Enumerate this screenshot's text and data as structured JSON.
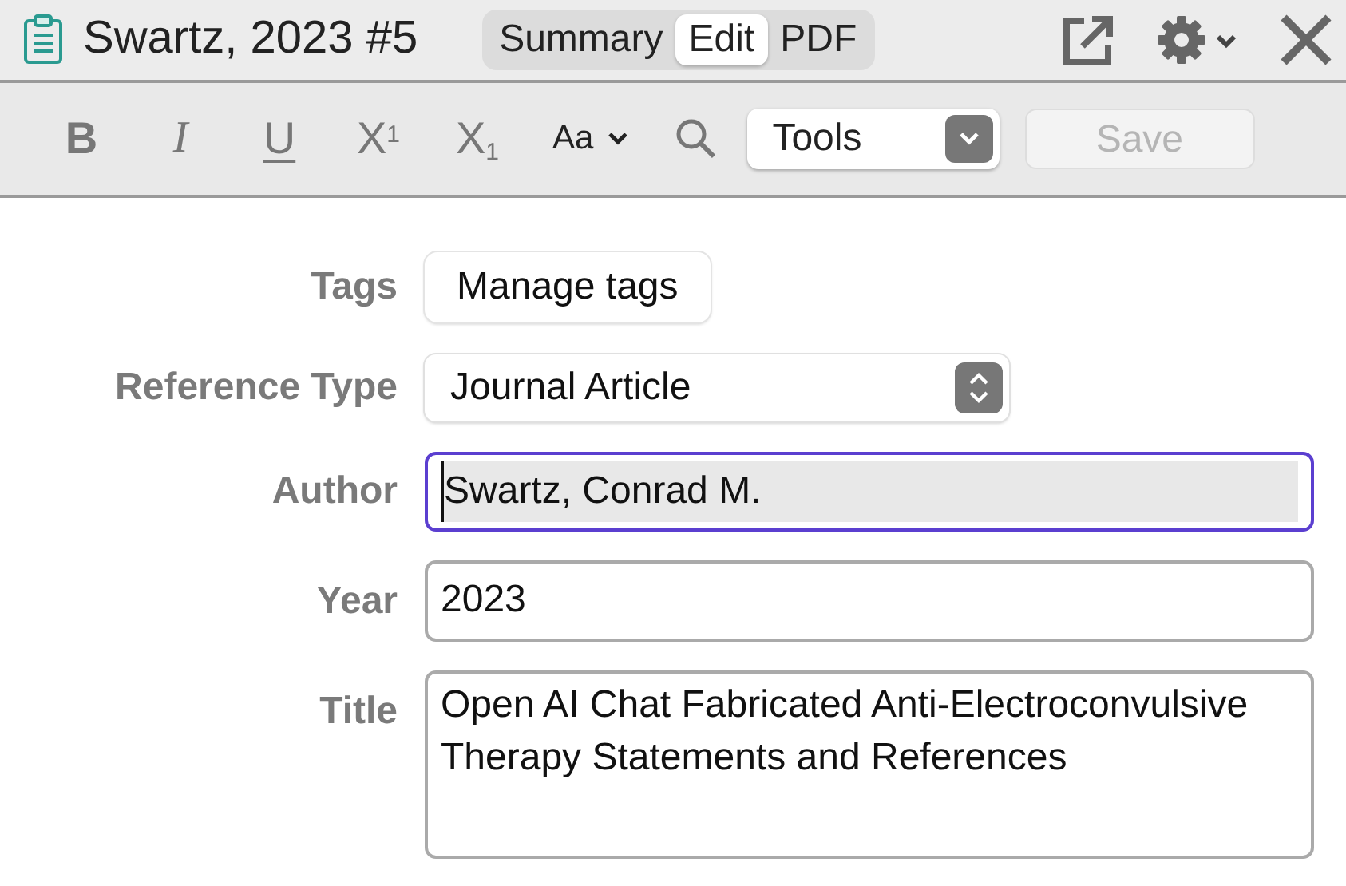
{
  "header": {
    "title": "Swartz, 2023 #5",
    "tabs": [
      {
        "label": "Summary",
        "selected": false
      },
      {
        "label": "Edit",
        "selected": true
      },
      {
        "label": "PDF",
        "selected": false
      }
    ]
  },
  "toolbar": {
    "format_buttons": [
      {
        "label": "B",
        "kind": "bold"
      },
      {
        "label": "I",
        "kind": "italic"
      },
      {
        "label": "U",
        "kind": "underline"
      },
      {
        "label": "X$^{1}$",
        "kind": "script"
      },
      {
        "label": "X$_{1}$",
        "kind": "script"
      }
    ],
    "font_button": "Aa",
    "tools_select": "Tools",
    "save_button": {
      "label": "Save",
      "disabled": true
    }
  },
  "fields": [
    {
      "label": "Tags",
      "kind": "button",
      "value": "Manage tags"
    },
    {
      "label": "Reference Type",
      "kind": "select",
      "value": "Journal Article"
    },
    {
      "label": "Author",
      "kind": "input",
      "value": "Swartz, Conrad M.",
      "focused": true
    },
    {
      "label": "Year",
      "kind": "input",
      "value": "2023",
      "focused": false
    },
    {
      "label": "Title",
      "kind": "textarea",
      "value": "Open AI Chat Fabricated Anti-Electroconvulsive Therapy Statements and References",
      "focused": false
    }
  ]
}
